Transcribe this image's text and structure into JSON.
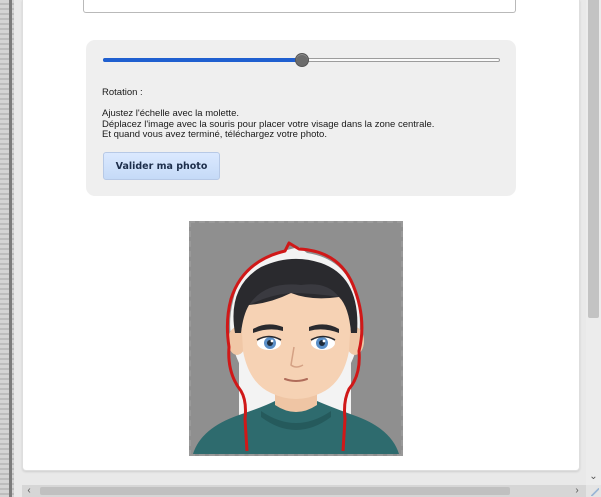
{
  "slider": {
    "value": 0.5,
    "label": "scale slider"
  },
  "rotation_label": "Rotation :",
  "instructions": {
    "line1": "Ajustez l'échelle avec la molette.",
    "line2": "Déplacez l'image avec la souris pour placer votre visage dans la zone centrale.",
    "line3": "Et quand vous avez terminé, téléchargez votre photo."
  },
  "buttons": {
    "validate": "Valider ma photo"
  },
  "icons": {
    "scroll_down": "chevron-down-icon",
    "scroll_left": "chevron-left-icon",
    "scroll_right": "chevron-right-icon",
    "resize_grip": "resize-grip-icon"
  },
  "colors": {
    "slider_fill": "#1f5fd0",
    "button_bg": "#c5daf7",
    "face_outline": "#d01818",
    "photo_bg": "#8f8f8f"
  }
}
